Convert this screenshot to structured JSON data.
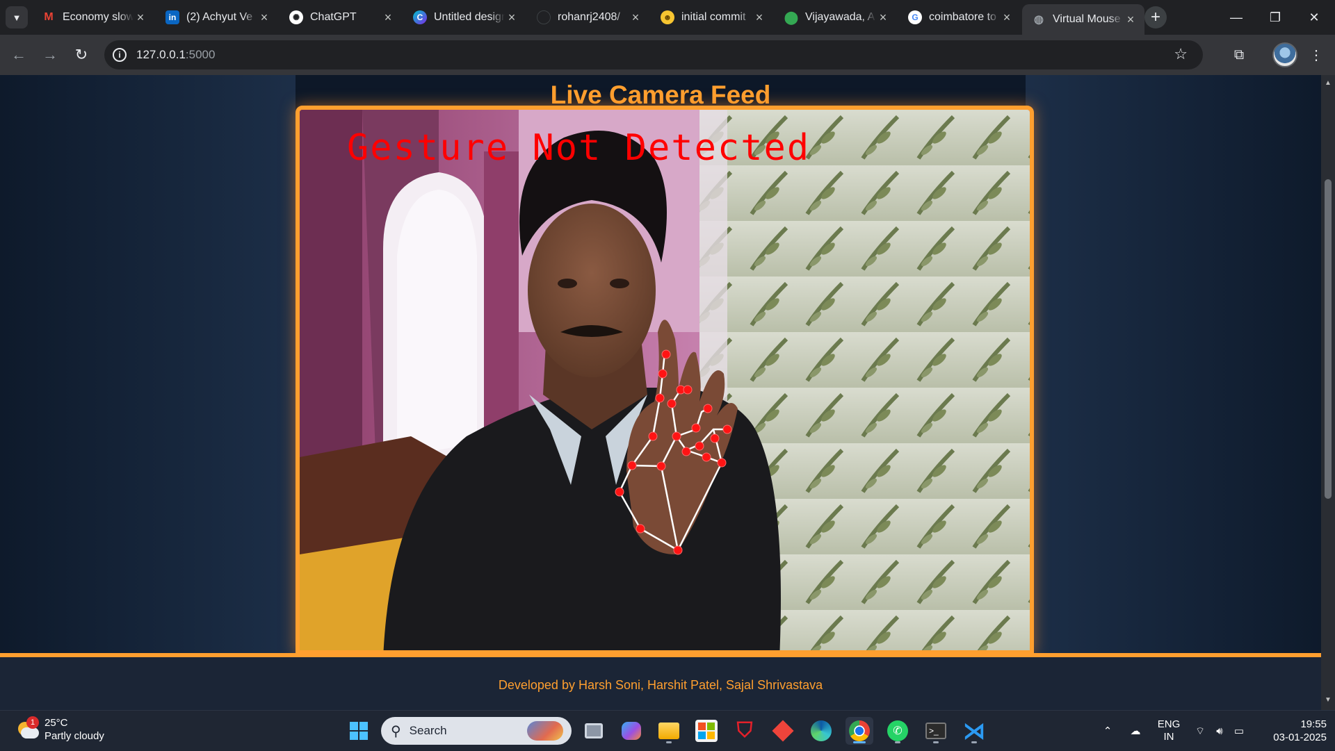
{
  "browser": {
    "tabs": [
      {
        "title": "Economy slows",
        "favicon": "gmail-icon",
        "active": false
      },
      {
        "title": "(2) Achyut Ve",
        "favicon": "linkedin-icon",
        "active": false
      },
      {
        "title": "ChatGPT",
        "favicon": "chatgpt-icon",
        "active": false
      },
      {
        "title": "Untitled design",
        "favicon": "canva-icon",
        "active": false
      },
      {
        "title": "rohanrj2408/",
        "favicon": "github-icon",
        "active": false
      },
      {
        "title": "initial commit",
        "favicon": "emoji-icon",
        "active": false
      },
      {
        "title": "Vijayawada, A",
        "favicon": "maps-icon",
        "active": false
      },
      {
        "title": "coimbatore to",
        "favicon": "google-icon",
        "active": false
      },
      {
        "title": "Virtual Mouse",
        "favicon": "globe-icon",
        "active": true
      }
    ],
    "url_host": "127.0.0.1",
    "url_port": ":5000"
  },
  "page": {
    "title": "Live Camera Feed",
    "overlay_text": "Gesture Not Detected",
    "footer": "Developed by Harsh Soni, Harshit Patel, Sajal Shrivastava"
  },
  "taskbar": {
    "weather_temp": "25°C",
    "weather_desc": "Partly cloudy",
    "weather_badge": "1",
    "search_label": "Search",
    "lang_top": "ENG",
    "lang_bottom": "IN",
    "time": "19:55",
    "date": "03-01-2025"
  },
  "colors": {
    "accent": "#ff9f2f",
    "overlay_text": "#ff0000",
    "landmark": "#ff0000"
  }
}
